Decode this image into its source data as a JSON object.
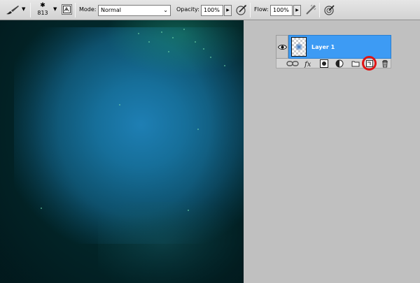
{
  "options_bar": {
    "tool_icon": "brush-icon",
    "brush_size": "813",
    "mode_label": "Mode:",
    "mode_value": "Normal",
    "opacity_label": "Opacity:",
    "opacity_value": "100%",
    "flow_label": "Flow:",
    "flow_value": "100%"
  },
  "layers_panel": {
    "layer": {
      "name": "Layer 1",
      "visible": true,
      "selected": true
    },
    "toolbar_icons": [
      "link-icon",
      "fx-icon",
      "mask-icon",
      "adjustment-icon",
      "group-folder-icon",
      "new-layer-icon",
      "trash-icon"
    ],
    "highlighted_icon": "new-layer-icon"
  },
  "colors": {
    "selection": "#3d9bf4",
    "highlight_ring": "#e01414",
    "canvas_base": "#022a2d",
    "canvas_glow": "#1e7fb4"
  }
}
